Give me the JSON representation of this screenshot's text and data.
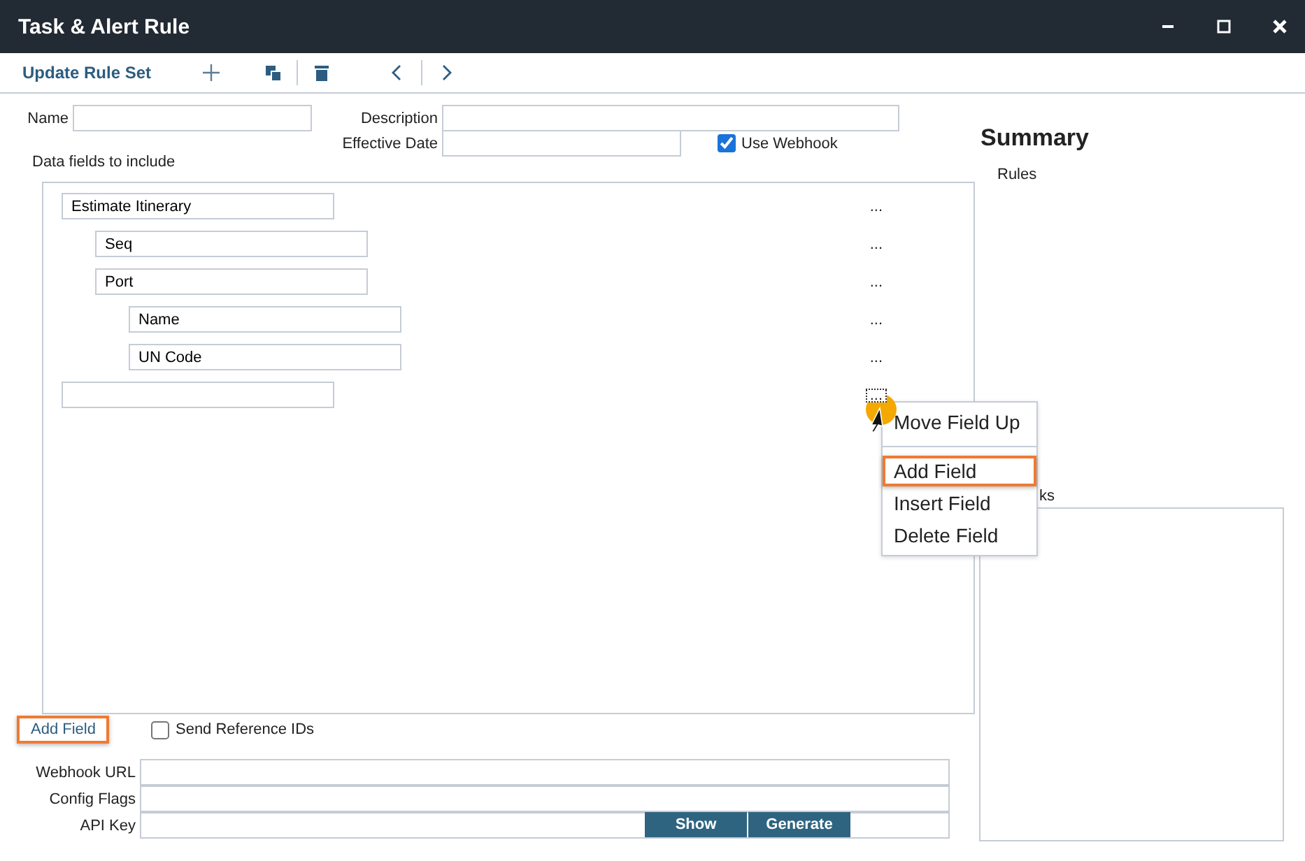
{
  "window": {
    "title": "Task & Alert Rule"
  },
  "toolbar": {
    "label": "Update Rule Set"
  },
  "form": {
    "name_label": "Name",
    "description_label": "Description",
    "effective_date_label": "Effective Date",
    "use_webhook": {
      "label": "Use Webhook",
      "checked": true
    }
  },
  "data_fields": {
    "label": "Data fields to include",
    "tree": [
      {
        "value": "Estimate Itinerary",
        "menu": "...",
        "focused": false,
        "children": [
          {
            "value": "Seq",
            "menu": "...",
            "focused": false
          },
          {
            "value": "Port",
            "menu": "...",
            "focused": false,
            "children": [
              {
                "value": "Name",
                "menu": "...",
                "focused": false
              },
              {
                "value": "UN Code",
                "menu": "...",
                "focused": false
              }
            ]
          }
        ]
      },
      {
        "menu": "...",
        "focused": true
      }
    ]
  },
  "context_menu": {
    "items": [
      {
        "label": "Move Field Up",
        "selected": false,
        "separator_after": true
      },
      {
        "label": "Add Field",
        "selected": true,
        "separator_after": false
      },
      {
        "label": "Insert Field",
        "selected": false,
        "separator_after": false
      },
      {
        "label": "Delete Field",
        "selected": false,
        "separator_after": false
      }
    ]
  },
  "add_field": {
    "label": "Add Field",
    "highlighted": true
  },
  "send_reference_ids": {
    "label": "Send Reference IDs",
    "checked": false
  },
  "webhook_fields": [
    {
      "label": "Webhook URL"
    },
    {
      "label": "Config Flags"
    },
    {
      "label": "API Key"
    }
  ],
  "api_key_buttons": [
    "Show",
    "Generate"
  ],
  "summary": {
    "title": "Summary",
    "rules_label": "Rules",
    "label_2": "ks"
  }
}
